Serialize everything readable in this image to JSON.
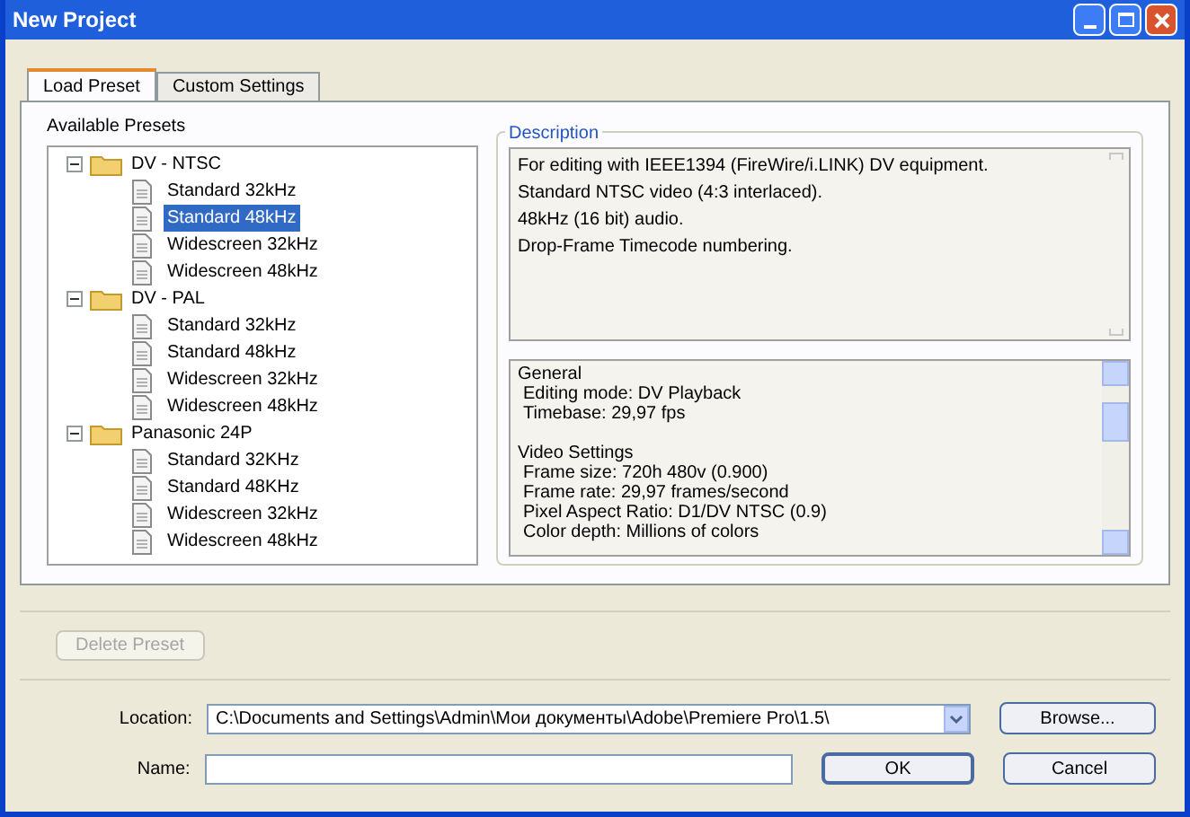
{
  "window": {
    "title": "New Project"
  },
  "tabs": [
    {
      "label": "Load Preset",
      "selected": true
    },
    {
      "label": "Custom Settings",
      "selected": false
    }
  ],
  "presets": {
    "label": "Available Presets",
    "tree": [
      {
        "label": "DV - NTSC",
        "expanded": true,
        "children": [
          {
            "label": "Standard 32kHz",
            "selected": false
          },
          {
            "label": "Standard 48kHz",
            "selected": true
          },
          {
            "label": "Widescreen 32kHz",
            "selected": false
          },
          {
            "label": "Widescreen 48kHz",
            "selected": false
          }
        ]
      },
      {
        "label": "DV - PAL",
        "expanded": true,
        "children": [
          {
            "label": "Standard 32kHz",
            "selected": false
          },
          {
            "label": "Standard 48kHz",
            "selected": false
          },
          {
            "label": "Widescreen 32kHz",
            "selected": false
          },
          {
            "label": "Widescreen 48kHz",
            "selected": false
          }
        ]
      },
      {
        "label": "Panasonic 24P",
        "expanded": true,
        "children": [
          {
            "label": "Standard 32KHz",
            "selected": false
          },
          {
            "label": "Standard 48KHz",
            "selected": false
          },
          {
            "label": "Widescreen 32kHz",
            "selected": false
          },
          {
            "label": "Widescreen 48kHz",
            "selected": false
          }
        ]
      }
    ]
  },
  "description": {
    "label": "Description",
    "lines": [
      "For editing with IEEE1394 (FireWire/i.LINK) DV equipment.",
      "Standard NTSC video (4:3 interlaced).",
      "48kHz (16 bit) audio.",
      "Drop-Frame Timecode numbering."
    ]
  },
  "details": [
    {
      "heading": "General",
      "lines": [
        "Editing mode: DV Playback",
        "Timebase: 29,97 fps"
      ]
    },
    {
      "heading": "Video Settings",
      "lines": [
        "Frame size: 720h 480v (0.900)",
        "Frame rate: 29,97 frames/second",
        "Pixel Aspect Ratio: D1/DV NTSC (0.9)",
        "Color depth: Millions of colors"
      ]
    }
  ],
  "delete_button": {
    "label": "Delete Preset",
    "disabled": true
  },
  "location": {
    "label": "Location:",
    "value": "C:\\Documents and Settings\\Admin\\Мои документы\\Adobe\\Premiere Pro\\1.5\\"
  },
  "browse_button": "Browse...",
  "name": {
    "label": "Name:"
  },
  "buttons": [
    "OK",
    "Cancel"
  ]
}
